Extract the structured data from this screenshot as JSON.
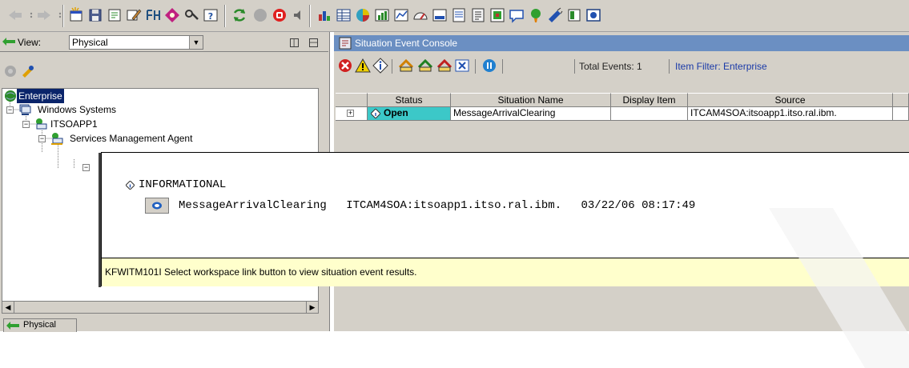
{
  "toolbar": {
    "icons": [
      "back-arrow-icon",
      "dropdown-icon",
      "forward-arrow-icon",
      "dropdown-icon",
      "new-window-icon",
      "save-icon",
      "properties-icon",
      "edit-workspace-icon",
      "situation-editor-icon",
      "query-editor-icon",
      "policy-icon",
      "help-icon",
      "refresh-icon",
      "stop-grey-icon",
      "stop-red-icon",
      "speaker-icon",
      "chart-bar-icon",
      "table-icon",
      "pie-chart-icon",
      "line-chart-icon",
      "plot-chart-icon",
      "gauge-icon",
      "circular-gauge-icon",
      "notepad-icon",
      "event-console-icon",
      "message-log-icon",
      "graphic-view-icon",
      "browser-icon",
      "take-action-icon",
      "terminal-icon",
      "topology-icon"
    ]
  },
  "left": {
    "view_label": "View:",
    "view_value": "Physical",
    "tree": [
      {
        "label": "Enterprise",
        "selected": true
      },
      {
        "label": "Windows Systems"
      },
      {
        "label": "ITSOAPP1"
      },
      {
        "label": "Services Management Agent"
      }
    ],
    "bottom_tab": "Physical"
  },
  "right": {
    "title": "Situation Event Console",
    "total_events": "Total Events: 1",
    "item_filter": "Item Filter: Enterprise",
    "columns": [
      "Status",
      "Situation Name",
      "Display Item",
      "Source"
    ],
    "rows": [
      {
        "status": "Open",
        "situation": "MessageArrivalClearing",
        "display_item": "",
        "source": "ITCAM4SOA:itsoapp1.itso.ral.ibm."
      }
    ]
  },
  "popup": {
    "severity": "INFORMATIONAL",
    "situation": "MessageArrivalClearing",
    "source": "ITCAM4SOA:itsoapp1.itso.ral.ibm.",
    "timestamp": "03/22/06 08:17:49",
    "hint": "KFWITM101I Select workspace link button to view situation event results."
  }
}
